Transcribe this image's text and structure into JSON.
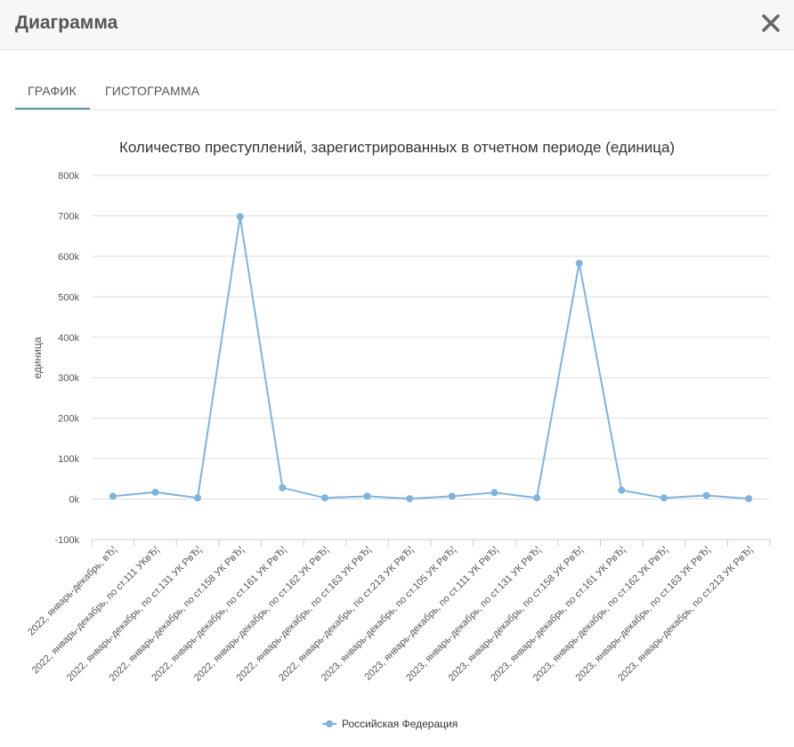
{
  "modal": {
    "title": "Диаграмма"
  },
  "tabs": [
    {
      "label": "ГРАФИК",
      "active": true
    },
    {
      "label": "ГИСТОГРАММА",
      "active": false
    }
  ],
  "colors": {
    "series": "#7fb3dc",
    "active_tab": "#5a93a8"
  },
  "chart_data": {
    "type": "line",
    "title": "Количество преступлений, зарегистрированных в отчетном периоде (единица)",
    "xlabel": "",
    "ylabel": "единица",
    "ylim": [
      -100000,
      800000
    ],
    "yticks": [
      -100000,
      0,
      100000,
      200000,
      300000,
      400000,
      500000,
      600000,
      700000,
      800000
    ],
    "ytick_labels": [
      "-100k",
      "0k",
      "100k",
      "200k",
      "300k",
      "400k",
      "500k",
      "600k",
      "700k",
      "800k"
    ],
    "grid": true,
    "legend_position": "bottom",
    "categories": [
      "2022, январь-декабрь, вЂ¦",
      "2022, январь-декабрь, по ст.111 УКвЂ¦",
      "2022, январь-декабрь, по ст.131 УК РвЂ¦",
      "2022, январь-декабрь, по ст.158 УК РвЂ¦",
      "2022, январь-декабрь, по ст.161 УК РвЂ¦",
      "2022, январь-декабрь, по ст.162 УК РвЂ¦",
      "2022, январь-декабрь, по ст.163 УК РвЂ¦",
      "2022, январь-декабрь, по ст.213 УК РвЂ¦",
      "2023, январь-декабрь, по ст.105 УК РвЂ¦",
      "2023, январь-декабрь, по ст.111 УК РвЂ¦",
      "2023, январь-декабрь, по ст.131 УК РвЂ¦",
      "2023, январь-декабрь, по ст.158 УК РвЂ¦",
      "2023, январь-декабрь, по ст.161 УК РвЂ¦",
      "2023, январь-декабрь, по ст.162 УК РвЂ¦",
      "2023, январь-декабрь, по ст.163 УК РвЂ¦",
      "2023, январь-декабрь, по ст.213 УК РвЂ¦"
    ],
    "series": [
      {
        "name": "Российская Федерация",
        "values": [
          7000,
          17000,
          3000,
          698000,
          28000,
          3000,
          7000,
          1000,
          7000,
          16000,
          3000,
          583000,
          22000,
          3000,
          9000,
          1000
        ]
      }
    ]
  }
}
